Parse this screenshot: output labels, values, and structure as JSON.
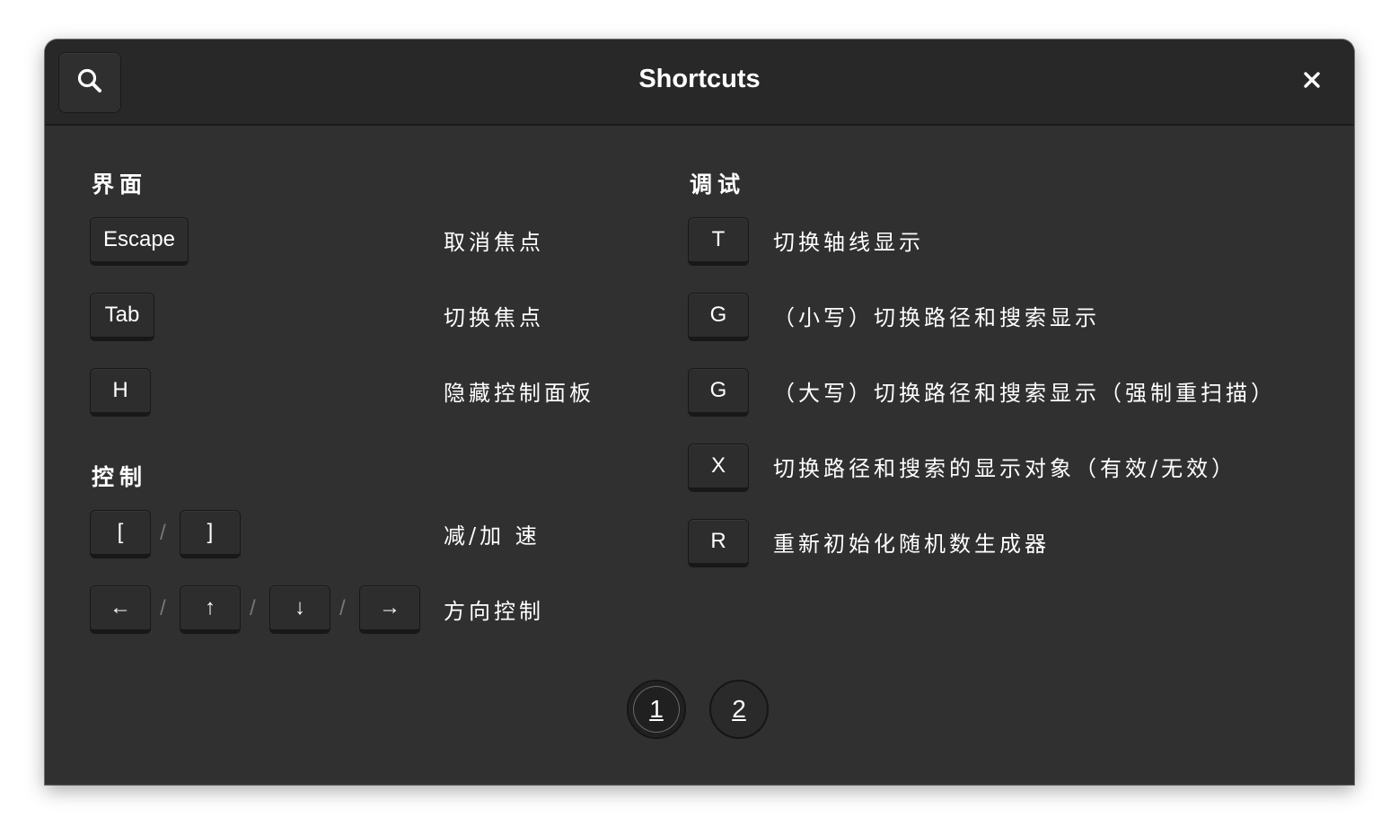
{
  "header": {
    "title": "Shortcuts",
    "search_icon": "search-icon",
    "close_icon": "close-icon"
  },
  "sections": {
    "interface": {
      "title": "界面",
      "rows": [
        {
          "keys": [
            "Escape"
          ],
          "description": "取消焦点"
        },
        {
          "keys": [
            "Tab"
          ],
          "description": "切换焦点"
        },
        {
          "keys": [
            "H"
          ],
          "description": "隐藏控制面板"
        }
      ]
    },
    "control": {
      "title": "控制",
      "rows": [
        {
          "keys": [
            "[",
            "]"
          ],
          "separator": "/",
          "description": "减/加 速"
        },
        {
          "keys": [
            "←",
            "↑",
            "↓",
            "→"
          ],
          "separator": "/",
          "description": "方向控制"
        }
      ]
    },
    "debug": {
      "title": "调试",
      "rows": [
        {
          "keys": [
            "T"
          ],
          "description": "切换轴线显示"
        },
        {
          "keys": [
            "G"
          ],
          "description": "（小写）切换路径和搜索显示"
        },
        {
          "keys": [
            "G"
          ],
          "description": "（大写）切换路径和搜索显示（强制重扫描）"
        },
        {
          "keys": [
            "X"
          ],
          "description": "切换路径和搜索的显示对象（有效/无效）"
        },
        {
          "keys": [
            "R"
          ],
          "description": "重新初始化随机数生成器"
        }
      ]
    }
  },
  "pagination": {
    "pages": [
      "1",
      "2"
    ],
    "current": "1"
  }
}
